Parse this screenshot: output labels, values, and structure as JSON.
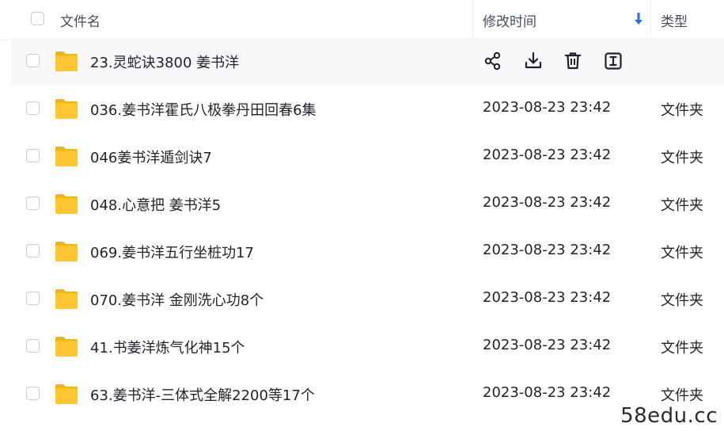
{
  "header": {
    "name_col": "文件名",
    "time_col": "修改时间",
    "type_col": "类型",
    "sort_icon": "arrow-down-icon",
    "sort_color": "#2a6cf6"
  },
  "rows": [
    {
      "name": "23.灵蛇诀3800 姜书洋",
      "time": "",
      "type": "",
      "hover": true
    },
    {
      "name": "036.姜书洋霍氏八极拳丹田回春6集",
      "time": "2023-08-23 23:42",
      "type": "文件夹"
    },
    {
      "name": "046姜书洋遁剑诀7",
      "time": "2023-08-23 23:42",
      "type": "文件夹"
    },
    {
      "name": "048.心意把 姜书洋5",
      "time": "2023-08-23 23:42",
      "type": "文件夹"
    },
    {
      "name": "069.姜书洋五行坐桩功17",
      "time": "2023-08-23 23:42",
      "type": "文件夹"
    },
    {
      "name": "070.姜书洋 金刚洗心功8个",
      "time": "2023-08-23 23:42",
      "type": "文件夹"
    },
    {
      "name": "41.书姜洋炼气化神15个",
      "time": "2023-08-23 23:42",
      "type": "文件夹"
    },
    {
      "name": "63.姜书洋-三体式全解2200等17个",
      "time": "2023-08-23 23:42",
      "type": "文件夹"
    }
  ],
  "row_actions": [
    "share-icon",
    "download-icon",
    "delete-icon",
    "rename-icon"
  ],
  "folder_color": "#ffc634",
  "watermark": "58edu.cc"
}
